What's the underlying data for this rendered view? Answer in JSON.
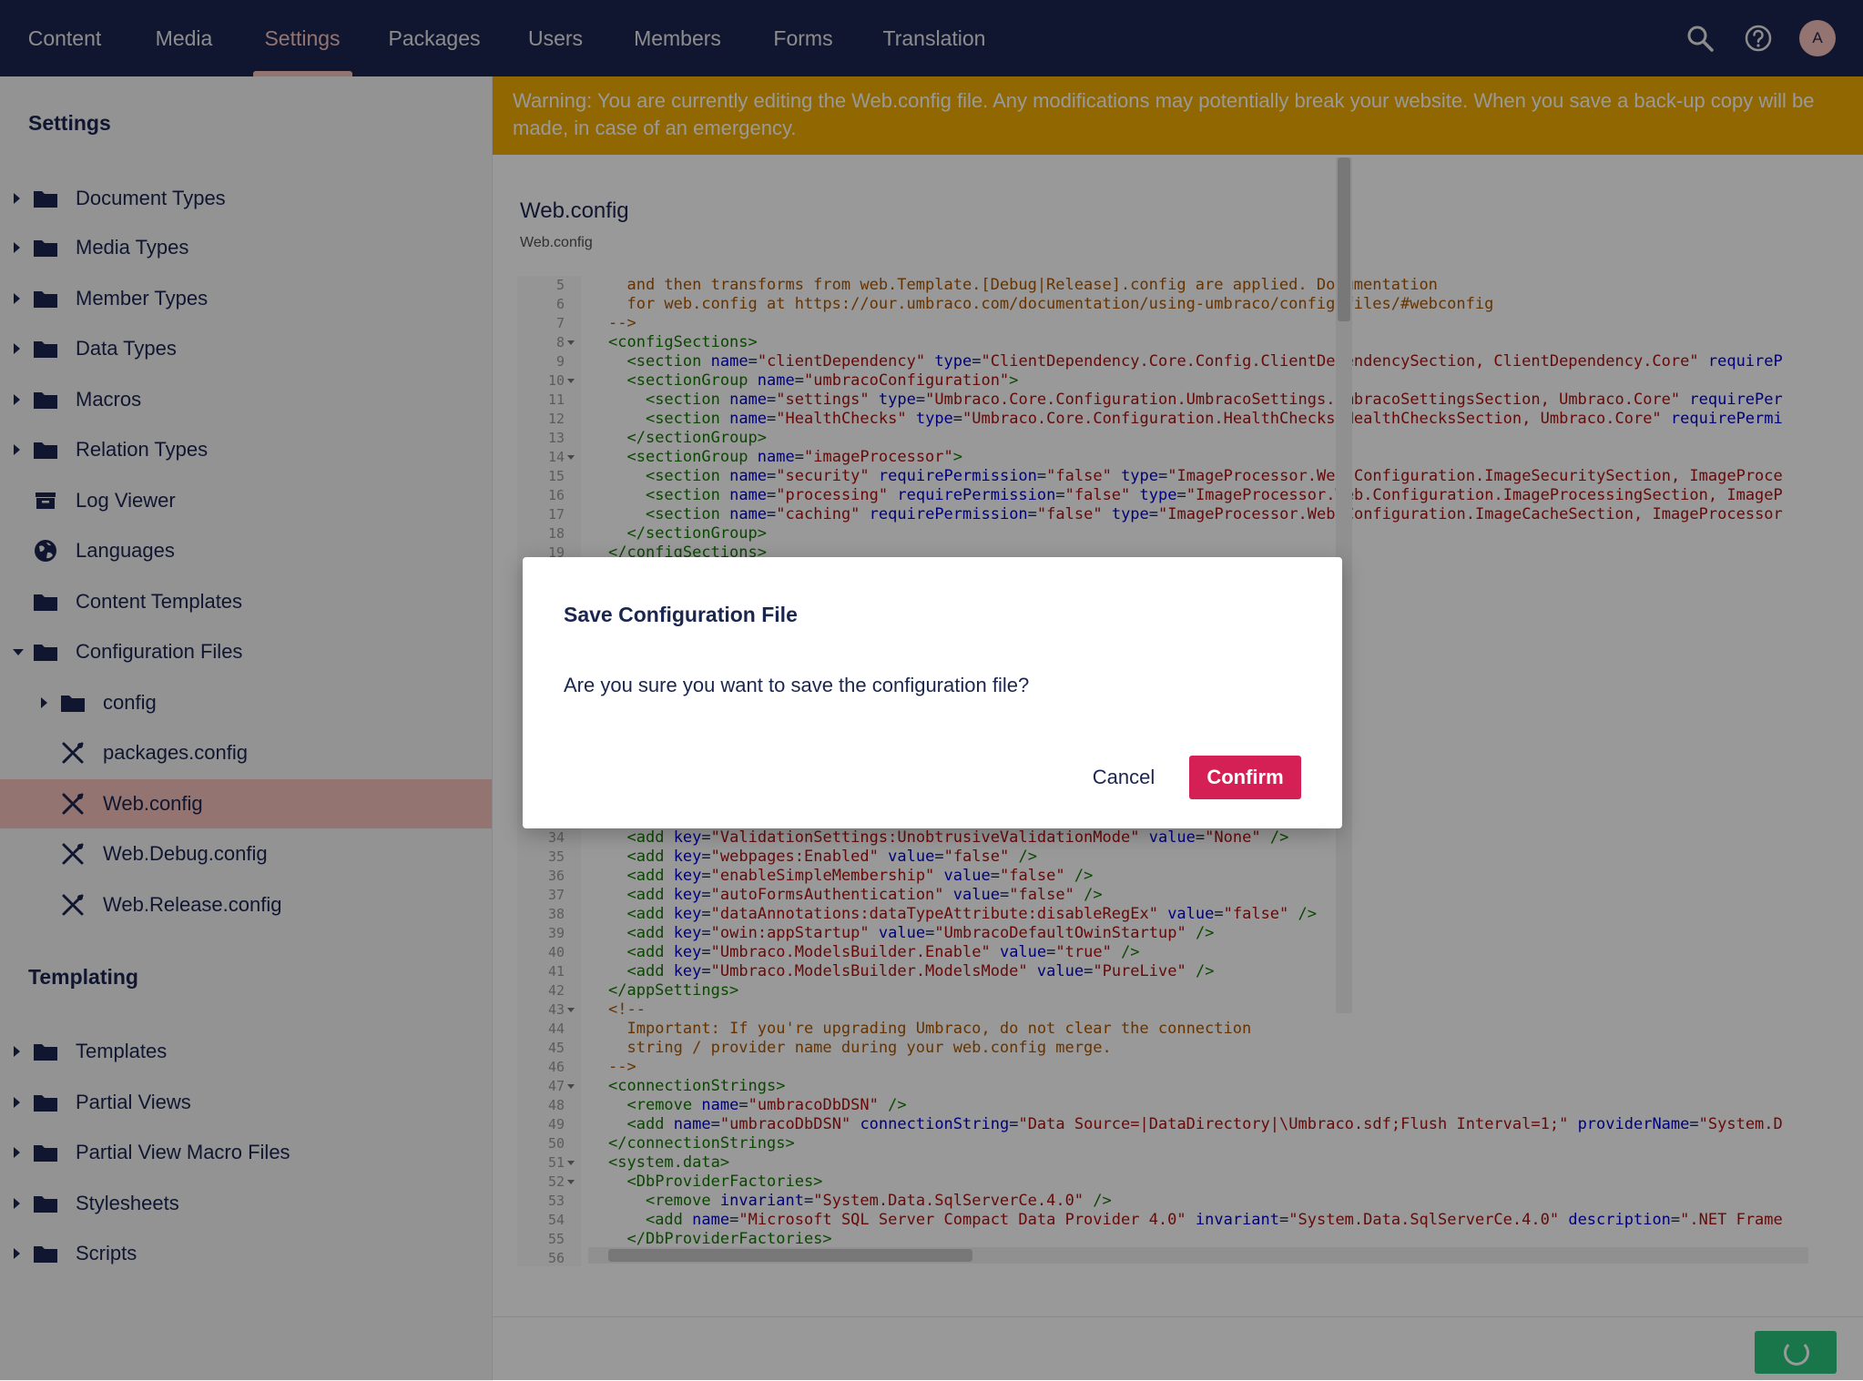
{
  "topnav": {
    "sections": [
      {
        "label": "Content"
      },
      {
        "label": "Media"
      },
      {
        "label": "Settings"
      },
      {
        "label": "Packages"
      },
      {
        "label": "Users"
      },
      {
        "label": "Members"
      },
      {
        "label": "Forms"
      },
      {
        "label": "Translation"
      }
    ],
    "active": "Settings",
    "avatar_initial": "A",
    "icons": [
      "search-icon",
      "help-icon"
    ]
  },
  "sidebar": {
    "settings_heading": "Settings",
    "settings_items": [
      {
        "label": "Document Types",
        "icon": "folder-icon"
      },
      {
        "label": "Media Types",
        "icon": "folder-icon"
      },
      {
        "label": "Member Types",
        "icon": "folder-icon"
      },
      {
        "label": "Data Types",
        "icon": "folder-icon"
      },
      {
        "label": "Macros",
        "icon": "folder-icon"
      },
      {
        "label": "Relation Types",
        "icon": "folder-icon"
      },
      {
        "label": "Log Viewer",
        "icon": "archive-box-icon"
      },
      {
        "label": "Languages",
        "icon": "globe-icon"
      },
      {
        "label": "Content Templates",
        "icon": "folder-icon"
      },
      {
        "label": "Configuration Files",
        "icon": "folder-icon"
      },
      {
        "label": "config",
        "icon": "folder-icon"
      },
      {
        "label": "packages.config",
        "icon": "wrench-screwdriver-icon"
      },
      {
        "label": "Web.config",
        "icon": "wrench-screwdriver-icon"
      },
      {
        "label": "Web.Debug.config",
        "icon": "wrench-screwdriver-icon"
      },
      {
        "label": "Web.Release.config",
        "icon": "wrench-screwdriver-icon"
      }
    ],
    "selected": "Web.config",
    "templating_heading": "Templating",
    "templating_items": [
      {
        "label": "Templates",
        "icon": "folder-icon"
      },
      {
        "label": "Partial Views",
        "icon": "folder-icon"
      },
      {
        "label": "Partial View Macro Files",
        "icon": "folder-icon"
      },
      {
        "label": "Stylesheets",
        "icon": "folder-icon"
      },
      {
        "label": "Scripts",
        "icon": "folder-icon"
      }
    ]
  },
  "warning": "Warning: You are currently editing the Web.config file. Any modifications may potentially break your website. When you save a back-up copy will be made, in case of an emergency.",
  "editor": {
    "title": "Web.config",
    "subtitle": "Web.config",
    "lines_top": [
      {
        "n": "5",
        "fold": false,
        "html": "  <span class=\"cmt\">and then transforms from web.Template.[Debug|Release].config are applied. Documentation</span>"
      },
      {
        "n": "6",
        "fold": false,
        "html": "  <span class=\"cmt\">for web.config at https://our.umbraco.com/documentation/using-umbraco/config-files/#webconfig</span>"
      },
      {
        "n": "7",
        "fold": false,
        "html": "<span class=\"cmt\">--&gt;</span>"
      },
      {
        "n": "8",
        "fold": true,
        "html": "<span class=\"tag\">&lt;configSections&gt;</span>"
      },
      {
        "n": "9",
        "fold": false,
        "html": "  <span class=\"tag\">&lt;section</span> <span class=\"attr\">name</span>=<span class=\"str\">\"clientDependency\"</span> <span class=\"attr\">type</span>=<span class=\"str\">\"ClientDependency.Core.Config.ClientDependencySection, ClientDependency.Core\"</span> <span class=\"attr\">requireP</span>"
      },
      {
        "n": "10",
        "fold": true,
        "html": "  <span class=\"tag\">&lt;sectionGroup</span> <span class=\"attr\">name</span>=<span class=\"str\">\"umbracoConfiguration\"</span><span class=\"tag\">&gt;</span>"
      },
      {
        "n": "11",
        "fold": false,
        "html": "    <span class=\"tag\">&lt;section</span> <span class=\"attr\">name</span>=<span class=\"str\">\"settings\"</span> <span class=\"attr\">type</span>=<span class=\"str\">\"Umbraco.Core.Configuration.UmbracoSettings.UmbracoSettingsSection, Umbraco.Core\"</span> <span class=\"attr\">requirePer</span>"
      },
      {
        "n": "12",
        "fold": false,
        "html": "    <span class=\"tag\">&lt;section</span> <span class=\"attr\">name</span>=<span class=\"str\">\"HealthChecks\"</span> <span class=\"attr\">type</span>=<span class=\"str\">\"Umbraco.Core.Configuration.HealthChecks.HealthChecksSection, Umbraco.Core\"</span> <span class=\"attr\">requirePermi</span>"
      },
      {
        "n": "13",
        "fold": false,
        "html": "  <span class=\"tag\">&lt;/sectionGroup&gt;</span>"
      },
      {
        "n": "14",
        "fold": true,
        "html": "  <span class=\"tag\">&lt;sectionGroup</span> <span class=\"attr\">name</span>=<span class=\"str\">\"imageProcessor\"</span><span class=\"tag\">&gt;</span>"
      },
      {
        "n": "15",
        "fold": false,
        "html": "    <span class=\"tag\">&lt;section</span> <span class=\"attr\">name</span>=<span class=\"str\">\"security\"</span> <span class=\"attr\">requirePermission</span>=<span class=\"str\">\"false\"</span> <span class=\"attr\">type</span>=<span class=\"str\">\"ImageProcessor.Web.Configuration.ImageSecuritySection, ImageProce</span>"
      },
      {
        "n": "16",
        "fold": false,
        "html": "    <span class=\"tag\">&lt;section</span> <span class=\"attr\">name</span>=<span class=\"str\">\"processing\"</span> <span class=\"attr\">requirePermission</span>=<span class=\"str\">\"false\"</span> <span class=\"attr\">type</span>=<span class=\"str\">\"ImageProcessor.Web.Configuration.ImageProcessingSection, ImageP</span>"
      },
      {
        "n": "17",
        "fold": false,
        "html": "    <span class=\"tag\">&lt;section</span> <span class=\"attr\">name</span>=<span class=\"str\">\"caching\"</span> <span class=\"attr\">requirePermission</span>=<span class=\"str\">\"false\"</span> <span class=\"attr\">type</span>=<span class=\"str\">\"ImageProcessor.Web.Configuration.ImageCacheSection, ImageProcessor</span>"
      },
      {
        "n": "18",
        "fold": false,
        "html": "  <span class=\"tag\">&lt;/sectionGroup&gt;</span>"
      },
      {
        "n": "19",
        "fold": false,
        "html": "<span class=\"tag\">&lt;/configSections&gt;</span>"
      }
    ],
    "lines_bottom": [
      {
        "n": "34",
        "fold": false,
        "html": "  <span class=\"tag\">&lt;add</span> <span class=\"attr\">key</span>=<span class=\"str\">\"ValidationSettings:UnobtrusiveValidationMode\"</span> <span class=\"attr\">value</span>=<span class=\"str\">\"None\"</span> <span class=\"tag\">/&gt;</span>"
      },
      {
        "n": "35",
        "fold": false,
        "html": "  <span class=\"tag\">&lt;add</span> <span class=\"attr\">key</span>=<span class=\"str\">\"webpages:Enabled\"</span> <span class=\"attr\">value</span>=<span class=\"str\">\"false\"</span> <span class=\"tag\">/&gt;</span>"
      },
      {
        "n": "36",
        "fold": false,
        "html": "  <span class=\"tag\">&lt;add</span> <span class=\"attr\">key</span>=<span class=\"str\">\"enableSimpleMembership\"</span> <span class=\"attr\">value</span>=<span class=\"str\">\"false\"</span> <span class=\"tag\">/&gt;</span>"
      },
      {
        "n": "37",
        "fold": false,
        "html": "  <span class=\"tag\">&lt;add</span> <span class=\"attr\">key</span>=<span class=\"str\">\"autoFormsAuthentication\"</span> <span class=\"attr\">value</span>=<span class=\"str\">\"false\"</span> <span class=\"tag\">/&gt;</span>"
      },
      {
        "n": "38",
        "fold": false,
        "html": "  <span class=\"tag\">&lt;add</span> <span class=\"attr\">key</span>=<span class=\"str\">\"dataAnnotations:dataTypeAttribute:disableRegEx\"</span> <span class=\"attr\">value</span>=<span class=\"str\">\"false\"</span> <span class=\"tag\">/&gt;</span>"
      },
      {
        "n": "39",
        "fold": false,
        "html": "  <span class=\"tag\">&lt;add</span> <span class=\"attr\">key</span>=<span class=\"str\">\"owin:appStartup\"</span> <span class=\"attr\">value</span>=<span class=\"str\">\"UmbracoDefaultOwinStartup\"</span> <span class=\"tag\">/&gt;</span>"
      },
      {
        "n": "40",
        "fold": false,
        "html": "  <span class=\"tag\">&lt;add</span> <span class=\"attr\">key</span>=<span class=\"str\">\"Umbraco.ModelsBuilder.Enable\"</span> <span class=\"attr\">value</span>=<span class=\"str\">\"true\"</span> <span class=\"tag\">/&gt;</span>"
      },
      {
        "n": "41",
        "fold": false,
        "html": "  <span class=\"tag\">&lt;add</span> <span class=\"attr\">key</span>=<span class=\"str\">\"Umbraco.ModelsBuilder.ModelsMode\"</span> <span class=\"attr\">value</span>=<span class=\"str\">\"PureLive\"</span> <span class=\"tag\">/&gt;</span>"
      },
      {
        "n": "42",
        "fold": false,
        "html": "<span class=\"tag\">&lt;/appSettings&gt;</span>"
      },
      {
        "n": "43",
        "fold": true,
        "html": "<span class=\"cmt\">&lt;!--</span>"
      },
      {
        "n": "44",
        "fold": false,
        "html": "  <span class=\"cmt\">Important: If you're upgrading Umbraco, do not clear the connection</span>"
      },
      {
        "n": "45",
        "fold": false,
        "html": "  <span class=\"cmt\">string / provider name during your web.config merge.</span>"
      },
      {
        "n": "46",
        "fold": false,
        "html": "<span class=\"cmt\">--&gt;</span>"
      },
      {
        "n": "47",
        "fold": true,
        "html": "<span class=\"tag\">&lt;connectionStrings&gt;</span>"
      },
      {
        "n": "48",
        "fold": false,
        "html": "  <span class=\"tag\">&lt;remove</span> <span class=\"attr\">name</span>=<span class=\"str\">\"umbracoDbDSN\"</span> <span class=\"tag\">/&gt;</span>"
      },
      {
        "n": "49",
        "fold": false,
        "html": "  <span class=\"tag\">&lt;add</span> <span class=\"attr\">name</span>=<span class=\"str\">\"umbracoDbDSN\"</span> <span class=\"attr\">connectionString</span>=<span class=\"str\">\"Data Source=|DataDirectory|\\Umbraco.sdf;Flush Interval=1;\"</span> <span class=\"attr\">providerName</span>=<span class=\"str\">\"System.D</span>"
      },
      {
        "n": "50",
        "fold": false,
        "html": "<span class=\"tag\">&lt;/connectionStrings&gt;</span>"
      },
      {
        "n": "51",
        "fold": true,
        "html": "<span class=\"tag\">&lt;system.data&gt;</span>"
      },
      {
        "n": "52",
        "fold": true,
        "html": "  <span class=\"tag\">&lt;DbProviderFactories&gt;</span>"
      },
      {
        "n": "53",
        "fold": false,
        "html": "    <span class=\"tag\">&lt;remove</span> <span class=\"attr\">invariant</span>=<span class=\"str\">\"System.Data.SqlServerCe.4.0\"</span> <span class=\"tag\">/&gt;</span>"
      },
      {
        "n": "54",
        "fold": false,
        "html": "    <span class=\"tag\">&lt;add</span> <span class=\"attr\">name</span>=<span class=\"str\">\"Microsoft SQL Server Compact Data Provider 4.0\"</span> <span class=\"attr\">invariant</span>=<span class=\"str\">\"System.Data.SqlServerCe.4.0\"</span> <span class=\"attr\">description</span>=<span class=\"str\">\".NET Frame</span>"
      },
      {
        "n": "55",
        "fold": false,
        "html": "  <span class=\"tag\">&lt;/DbProviderFactories&gt;</span>"
      },
      {
        "n": "56",
        "fold": false,
        "html": ""
      }
    ]
  },
  "dialog": {
    "title": "Save Configuration File",
    "message": "Are you sure you want to save the configuration file?",
    "cancel_label": "Cancel",
    "confirm_label": "Confirm"
  },
  "colors": {
    "nav_bg": "#1b264f",
    "accent_pink": "#f5c1bc",
    "warning_bg": "#f0ac00",
    "confirm_bg": "#d42054",
    "save_bg": "#2bc37c"
  }
}
